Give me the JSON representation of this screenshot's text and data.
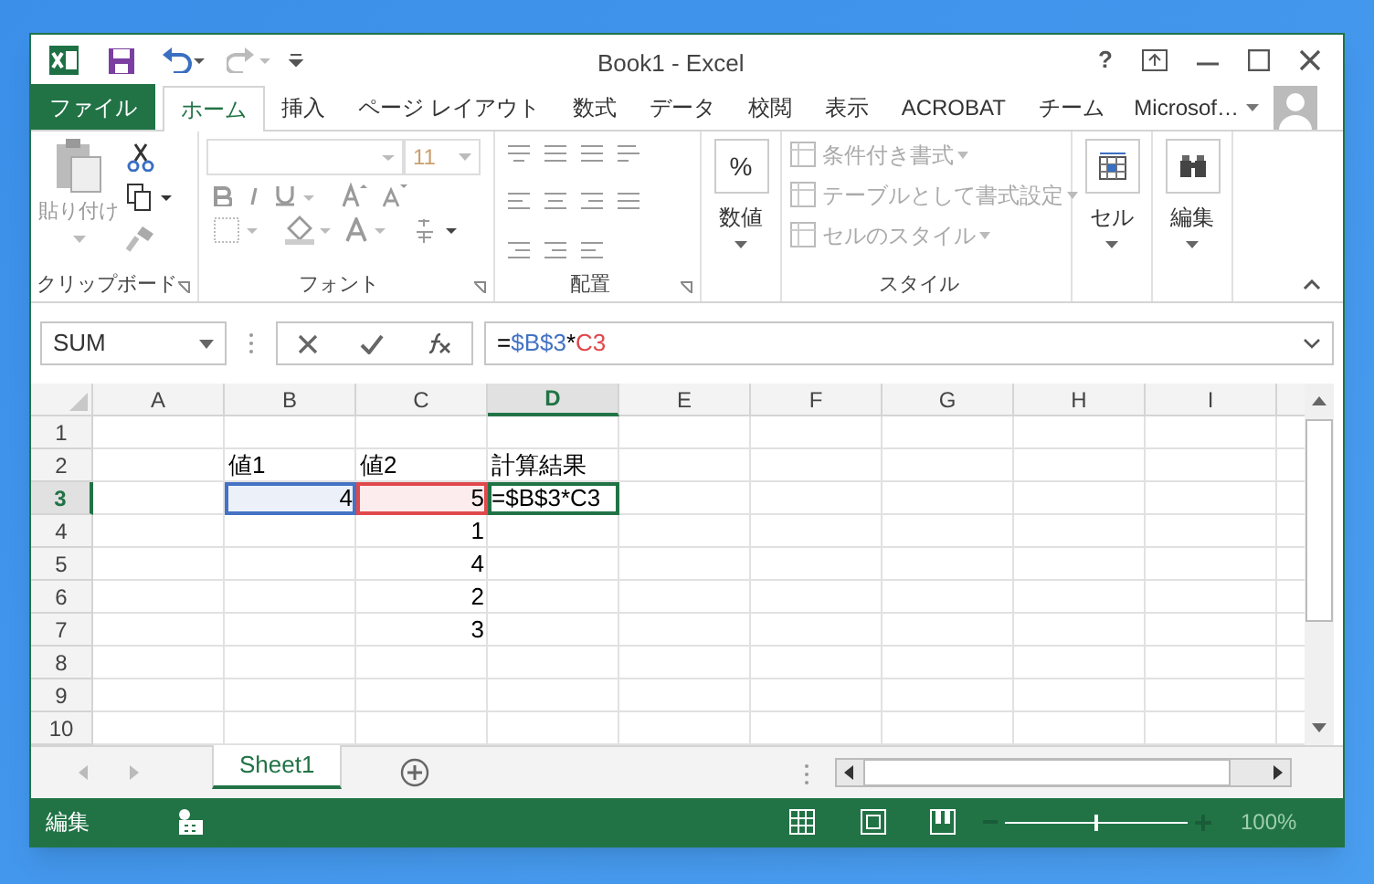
{
  "window": {
    "title": "Book1 - Excel",
    "help": "?"
  },
  "ribbon_tabs": [
    {
      "label": "ファイル",
      "kind": "file",
      "selected": false
    },
    {
      "label": "ホーム",
      "kind": "tab",
      "selected": true
    },
    {
      "label": "挿入",
      "kind": "tab",
      "selected": false
    },
    {
      "label": "ページ レイアウト",
      "kind": "tab",
      "selected": false
    },
    {
      "label": "数式",
      "kind": "tab",
      "selected": false
    },
    {
      "label": "データ",
      "kind": "tab",
      "selected": false
    },
    {
      "label": "校閲",
      "kind": "tab",
      "selected": false
    },
    {
      "label": "表示",
      "kind": "tab",
      "selected": false
    },
    {
      "label": "ACROBAT",
      "kind": "tab",
      "selected": false
    },
    {
      "label": "チーム",
      "kind": "tab",
      "selected": false
    }
  ],
  "account": {
    "name": "Microsof…"
  },
  "ribbon": {
    "clipboard": {
      "paste": "貼り付け",
      "label": "クリップボード"
    },
    "font": {
      "size": "11",
      "label": "フォント"
    },
    "alignment": {
      "label": "配置"
    },
    "number": {
      "symbol": "%",
      "button": "数値"
    },
    "styles": {
      "items": [
        "条件付き書式",
        "テーブルとして書式設定",
        "セルのスタイル"
      ],
      "label": "スタイル"
    },
    "cells": {
      "button": "セル"
    },
    "editing": {
      "button": "編集"
    }
  },
  "formula_bar": {
    "name_box": "SUM",
    "segments": [
      {
        "text": "=",
        "color": "#000000"
      },
      {
        "text": "$B$3",
        "color": "#4472c4"
      },
      {
        "text": "*",
        "color": "#000000"
      },
      {
        "text": "C3",
        "color": "#e0484c"
      }
    ]
  },
  "columns": [
    {
      "label": "A",
      "selected": false
    },
    {
      "label": "B",
      "selected": false
    },
    {
      "label": "C",
      "selected": false
    },
    {
      "label": "D",
      "selected": true
    },
    {
      "label": "E",
      "selected": false
    },
    {
      "label": "F",
      "selected": false
    },
    {
      "label": "G",
      "selected": false
    },
    {
      "label": "H",
      "selected": false
    },
    {
      "label": "I",
      "selected": false
    }
  ],
  "rows": [
    {
      "label": "1",
      "selected": false,
      "cells": [
        {},
        {},
        {},
        {},
        {},
        {},
        {},
        {},
        {}
      ]
    },
    {
      "label": "2",
      "selected": false,
      "cells": [
        {},
        {
          "text": "値1",
          "kind": "text"
        },
        {
          "text": "値2",
          "kind": "text"
        },
        {
          "text": "計算結果",
          "kind": "text"
        },
        {},
        {},
        {},
        {},
        {}
      ]
    },
    {
      "label": "3",
      "selected": true,
      "cells": [
        {},
        {
          "text": "4",
          "kind": "number",
          "color": "#4472c4"
        },
        {
          "text": "5",
          "kind": "number",
          "color": "#e0484c"
        },
        {
          "text": "=$B$3*C3",
          "kind": "editing"
        },
        {},
        {},
        {},
        {},
        {}
      ]
    },
    {
      "label": "4",
      "selected": false,
      "cells": [
        {},
        {},
        {
          "text": "1",
          "kind": "number"
        },
        {},
        {},
        {},
        {},
        {},
        {}
      ]
    },
    {
      "label": "5",
      "selected": false,
      "cells": [
        {},
        {},
        {
          "text": "4",
          "kind": "number"
        },
        {},
        {},
        {},
        {},
        {},
        {}
      ]
    },
    {
      "label": "6",
      "selected": false,
      "cells": [
        {},
        {},
        {
          "text": "2",
          "kind": "number"
        },
        {},
        {},
        {},
        {},
        {},
        {}
      ]
    },
    {
      "label": "7",
      "selected": false,
      "cells": [
        {},
        {},
        {
          "text": "3",
          "kind": "number"
        },
        {},
        {},
        {},
        {},
        {},
        {}
      ]
    },
    {
      "label": "8",
      "selected": false,
      "cells": [
        {},
        {},
        {},
        {},
        {},
        {},
        {},
        {},
        {}
      ]
    },
    {
      "label": "9",
      "selected": false,
      "cells": [
        {},
        {},
        {},
        {},
        {},
        {},
        {},
        {},
        {}
      ]
    },
    {
      "label": "10",
      "selected": false,
      "cells": [
        {},
        {},
        {},
        {},
        {},
        {},
        {},
        {},
        {}
      ]
    }
  ],
  "sheet_tabs": [
    {
      "label": "Sheet1",
      "selected": true
    }
  ],
  "status_bar": {
    "mode": "編集",
    "zoom": "100%",
    "zoom_level": {
      "level": 0.5
    }
  }
}
